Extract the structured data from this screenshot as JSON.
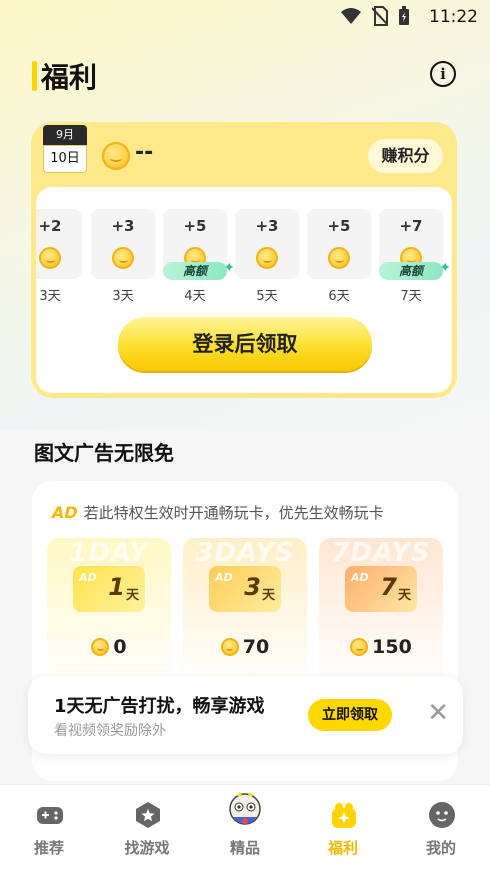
{
  "status_bar": {
    "time": "11:22"
  },
  "header": {
    "title": "福利",
    "info_icon": "info-icon"
  },
  "signin": {
    "calendar_month": "9月",
    "calendar_day": "10日",
    "balance": "--",
    "earn_button": "赚积分",
    "days": [
      {
        "points": "+2",
        "label": "3天",
        "bonus": ""
      },
      {
        "points": "+3",
        "label": "3天",
        "bonus": ""
      },
      {
        "points": "+5",
        "label": "4天",
        "bonus": "高额"
      },
      {
        "points": "+3",
        "label": "5天",
        "bonus": ""
      },
      {
        "points": "+5",
        "label": "6天",
        "bonus": ""
      },
      {
        "points": "+7",
        "label": "7天",
        "bonus": "高额"
      }
    ],
    "login_button": "登录后领取"
  },
  "ad_section": {
    "title": "图文广告无限免",
    "logo": "AD",
    "note": "若此特权生效时开通畅玩卡，优先生效畅玩卡",
    "plans": [
      {
        "watermark": "1DAY",
        "badge": "AD",
        "num": "1",
        "unit": "天",
        "price": "0",
        "color_top": "#fff7c4",
        "tile_color": "#ffe34d"
      },
      {
        "watermark": "3DAYS",
        "badge": "AD",
        "num": "3",
        "unit": "天",
        "price": "70",
        "color_top": "#ffefc7",
        "tile_color": "#ffcc55"
      },
      {
        "watermark": "7DAYS",
        "badge": "AD",
        "num": "7",
        "unit": "天",
        "price": "150",
        "color_top": "#ffe6d2",
        "tile_color": "#ffad6b"
      }
    ]
  },
  "toast": {
    "title": "1天无广告打扰，畅享游戏",
    "subtitle": "看视频领奖励除外",
    "button": "立即领取"
  },
  "tabs": [
    {
      "label": "推荐",
      "icon": "gamepad-icon"
    },
    {
      "label": "找游戏",
      "icon": "search-game-icon"
    },
    {
      "label": "精品",
      "icon": "mascot-icon"
    },
    {
      "label": "福利",
      "icon": "gift-icon"
    },
    {
      "label": "我的",
      "icon": "profile-icon"
    }
  ],
  "colors": {
    "accent": "#ffd400",
    "active_tab": "#f2b800"
  }
}
